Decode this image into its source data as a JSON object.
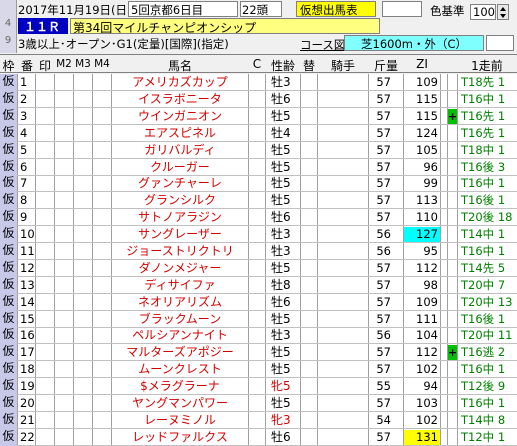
{
  "race": {
    "date": "2017年11月19日(日)",
    "venue": "5回京都6日目",
    "field": "22頭",
    "kari_label": "仮想出馬表",
    "irokijun_label": "色基準",
    "irokijun_value": "100",
    "race_no": "１１Ｒ",
    "race_name": "第34回マイルチャンピオンシップ",
    "conditions": "3歳以上･オープン･G1(定量)[国際](指定)",
    "course_label": "コース図",
    "course": "芝1600m・外（C）",
    "side_num": "4",
    "side_num2": "9"
  },
  "header": {
    "waku": "枠",
    "ban": "番",
    "in": "印",
    "m2": "M2",
    "m3": "M3",
    "m4": "M4",
    "name": "馬名",
    "c": "C",
    "seirei": "性齢",
    "tai": "替",
    "jockey": "騎手",
    "kinryo": "斤量",
    "zi": "ZI",
    "last1": "1走前"
  },
  "rows": [
    {
      "waku": "仮",
      "num": "1",
      "name": "アメリカズカップ",
      "sex": "牡3",
      "kin": "57",
      "zi": "109",
      "plus": "",
      "last": "T18先 1"
    },
    {
      "waku": "仮",
      "num": "2",
      "name": "イスラボニータ",
      "sex": "牡6",
      "kin": "57",
      "zi": "115",
      "plus": "",
      "last": "T16中 1"
    },
    {
      "waku": "仮",
      "num": "3",
      "name": "ウインガニオン",
      "sex": "牡5",
      "kin": "57",
      "zi": "115",
      "plus": "+",
      "last": "T16先 1"
    },
    {
      "waku": "仮",
      "num": "4",
      "name": "エアスピネル",
      "sex": "牡4",
      "kin": "57",
      "zi": "124",
      "plus": "",
      "last": "T16先 1"
    },
    {
      "waku": "仮",
      "num": "5",
      "name": "ガリバルディ",
      "sex": "牡5",
      "kin": "57",
      "zi": "105",
      "plus": "",
      "last": "T18中 1"
    },
    {
      "waku": "仮",
      "num": "6",
      "name": "クルーガー",
      "sex": "牡5",
      "kin": "57",
      "zi": "96",
      "plus": "",
      "last": "T16後 3"
    },
    {
      "waku": "仮",
      "num": "7",
      "name": "グァンチャーレ",
      "sex": "牡5",
      "kin": "57",
      "zi": "99",
      "plus": "",
      "last": "T16中 1"
    },
    {
      "waku": "仮",
      "num": "8",
      "name": "グランシルク",
      "sex": "牡5",
      "kin": "57",
      "zi": "113",
      "plus": "",
      "last": "T16後 1"
    },
    {
      "waku": "仮",
      "num": "9",
      "name": "サトノアラジン",
      "sex": "牡6",
      "kin": "57",
      "zi": "110",
      "plus": "",
      "last": "T20後 18"
    },
    {
      "waku": "仮",
      "num": "10",
      "name": "サングレーザー",
      "sex": "牡3",
      "kin": "56",
      "zi": "127",
      "plus": "",
      "last": "T14中 1"
    },
    {
      "waku": "仮",
      "num": "11",
      "name": "ジョーストリクトリ",
      "sex": "牡3",
      "kin": "56",
      "zi": "95",
      "plus": "",
      "last": "T16中 1"
    },
    {
      "waku": "仮",
      "num": "12",
      "name": "ダノンメジャー",
      "sex": "牡5",
      "kin": "57",
      "zi": "112",
      "plus": "",
      "last": "T14先 5"
    },
    {
      "waku": "仮",
      "num": "13",
      "name": "ディサイファ",
      "sex": "牡8",
      "kin": "57",
      "zi": "98",
      "plus": "",
      "last": "T20中 7"
    },
    {
      "waku": "仮",
      "num": "14",
      "name": "ネオリアリズム",
      "sex": "牡6",
      "kin": "57",
      "zi": "109",
      "plus": "",
      "last": "T20中 13"
    },
    {
      "waku": "仮",
      "num": "15",
      "name": "ブラックムーン",
      "sex": "牡5",
      "kin": "57",
      "zi": "111",
      "plus": "",
      "last": "T16後 1"
    },
    {
      "waku": "仮",
      "num": "16",
      "name": "ペルシアンナイト",
      "sex": "牡3",
      "kin": "56",
      "zi": "104",
      "plus": "",
      "last": "T20中 11"
    },
    {
      "waku": "仮",
      "num": "17",
      "name": "マルターズアポジー",
      "sex": "牡5",
      "kin": "57",
      "zi": "112",
      "plus": "+",
      "last": "T16逃 2"
    },
    {
      "waku": "仮",
      "num": "18",
      "name": "ムーンクレスト",
      "sex": "牡5",
      "kin": "57",
      "zi": "102",
      "plus": "",
      "last": "T16中 1"
    },
    {
      "waku": "仮",
      "num": "19",
      "name": "$メラグラーナ",
      "sex": "牝5",
      "kin": "55",
      "zi": "94",
      "plus": "",
      "last": "T12後 9"
    },
    {
      "waku": "仮",
      "num": "20",
      "name": "ヤングマンパワー",
      "sex": "牡5",
      "kin": "57",
      "zi": "103",
      "plus": "",
      "last": "T16中 1"
    },
    {
      "waku": "仮",
      "num": "21",
      "name": "レーヌミノル",
      "sex": "牝3",
      "kin": "54",
      "zi": "102",
      "plus": "",
      "last": "T14中 8"
    },
    {
      "waku": "仮",
      "num": "22",
      "name": "レッドファルクス",
      "sex": "牡6",
      "kin": "57",
      "zi": "131",
      "plus": "",
      "last": "T12中 1"
    }
  ],
  "colors": {
    "name_red": "#d40000",
    "zi_cyan": "#00ffff",
    "zi_yellow": "#ffff00",
    "plus_green": "#00c000",
    "racename_bg": "#ffff80",
    "waku_bg": "#c8c8e8",
    "yellow_box": "#ffff00",
    "course_bg": "#80ffff"
  }
}
